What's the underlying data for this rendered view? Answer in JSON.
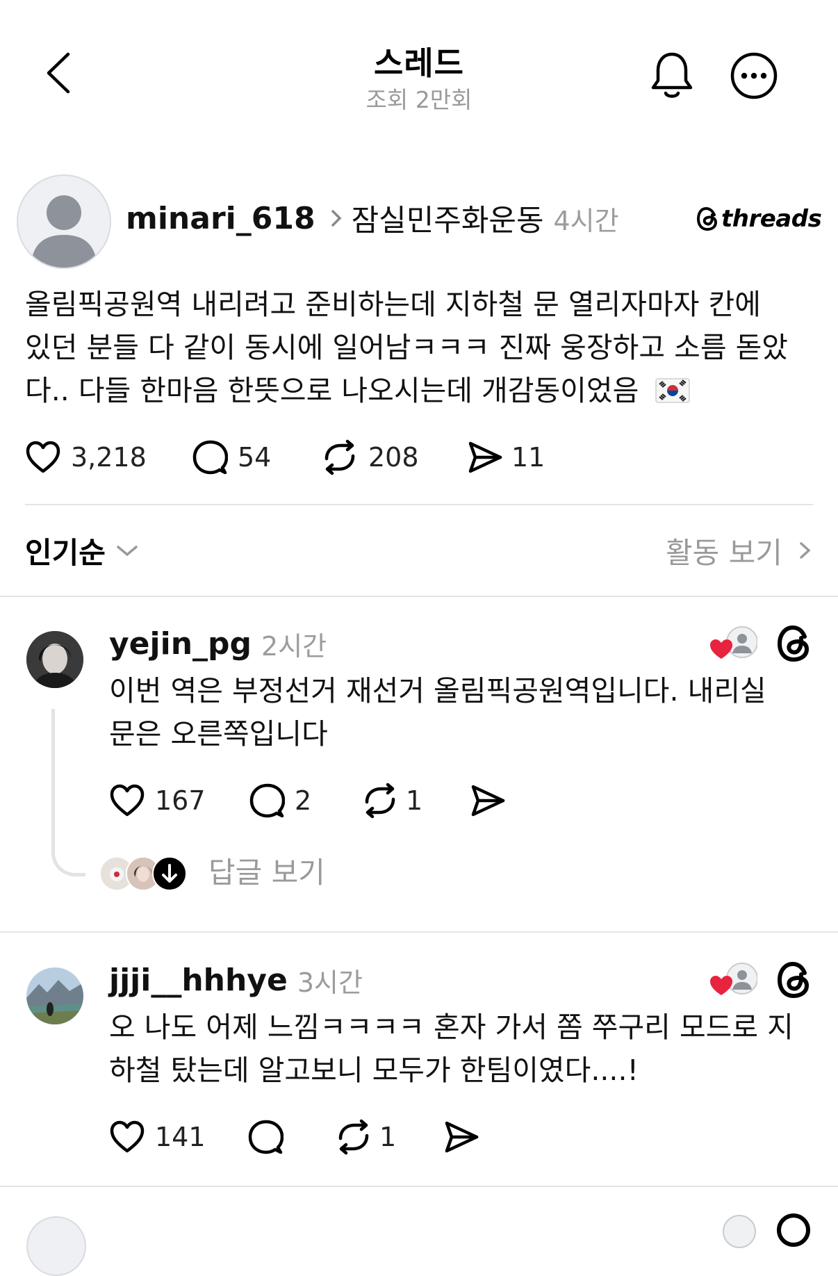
{
  "header": {
    "title": "스레드",
    "views": "조회 2만회"
  },
  "post": {
    "username": "minari_618",
    "community": "잠실민주화운동",
    "time": "4시간",
    "brand": "threads",
    "text_lines": [
      "올림픽공원역 내리려고 준비하는데 지하철 문 열리자마자 칸에",
      "있던 분들 다 같이 동시에 일어남ㅋㅋㅋ 진짜 웅장하고 소름 돋았",
      "다.. 다들 한마음 한뜻으로 나오시는데 개감동이었음"
    ],
    "stats": {
      "likes": "3,218",
      "comments": "54",
      "reposts": "208",
      "shares": "11"
    }
  },
  "sort": {
    "label": "인기순",
    "activity": "활동 보기"
  },
  "comments": [
    {
      "username": "yejin_pg",
      "time": "2시간",
      "text_lines": [
        "이번 역은 부정선거 재선거 올림픽공원역입니다. 내리실",
        "문은 오른쪽입니다"
      ],
      "stats": {
        "likes": "167",
        "comments": "2",
        "reposts": "1"
      },
      "replies_label": "답글 보기"
    },
    {
      "username": "jjji__hhhye",
      "time": "3시간",
      "text_lines": [
        "오 나도 어제 느낌ㅋㅋㅋㅋ 혼자 가서 쫌 쭈구리 모드로 지",
        "하철 탔는데 알고보니 모두가 한팀이였다....!"
      ],
      "stats": {
        "likes": "141",
        "reposts": "1"
      }
    }
  ],
  "colors": {
    "heart": "#e8233f",
    "muted": "#9a9a9a",
    "divider": "#e4e4e4"
  }
}
